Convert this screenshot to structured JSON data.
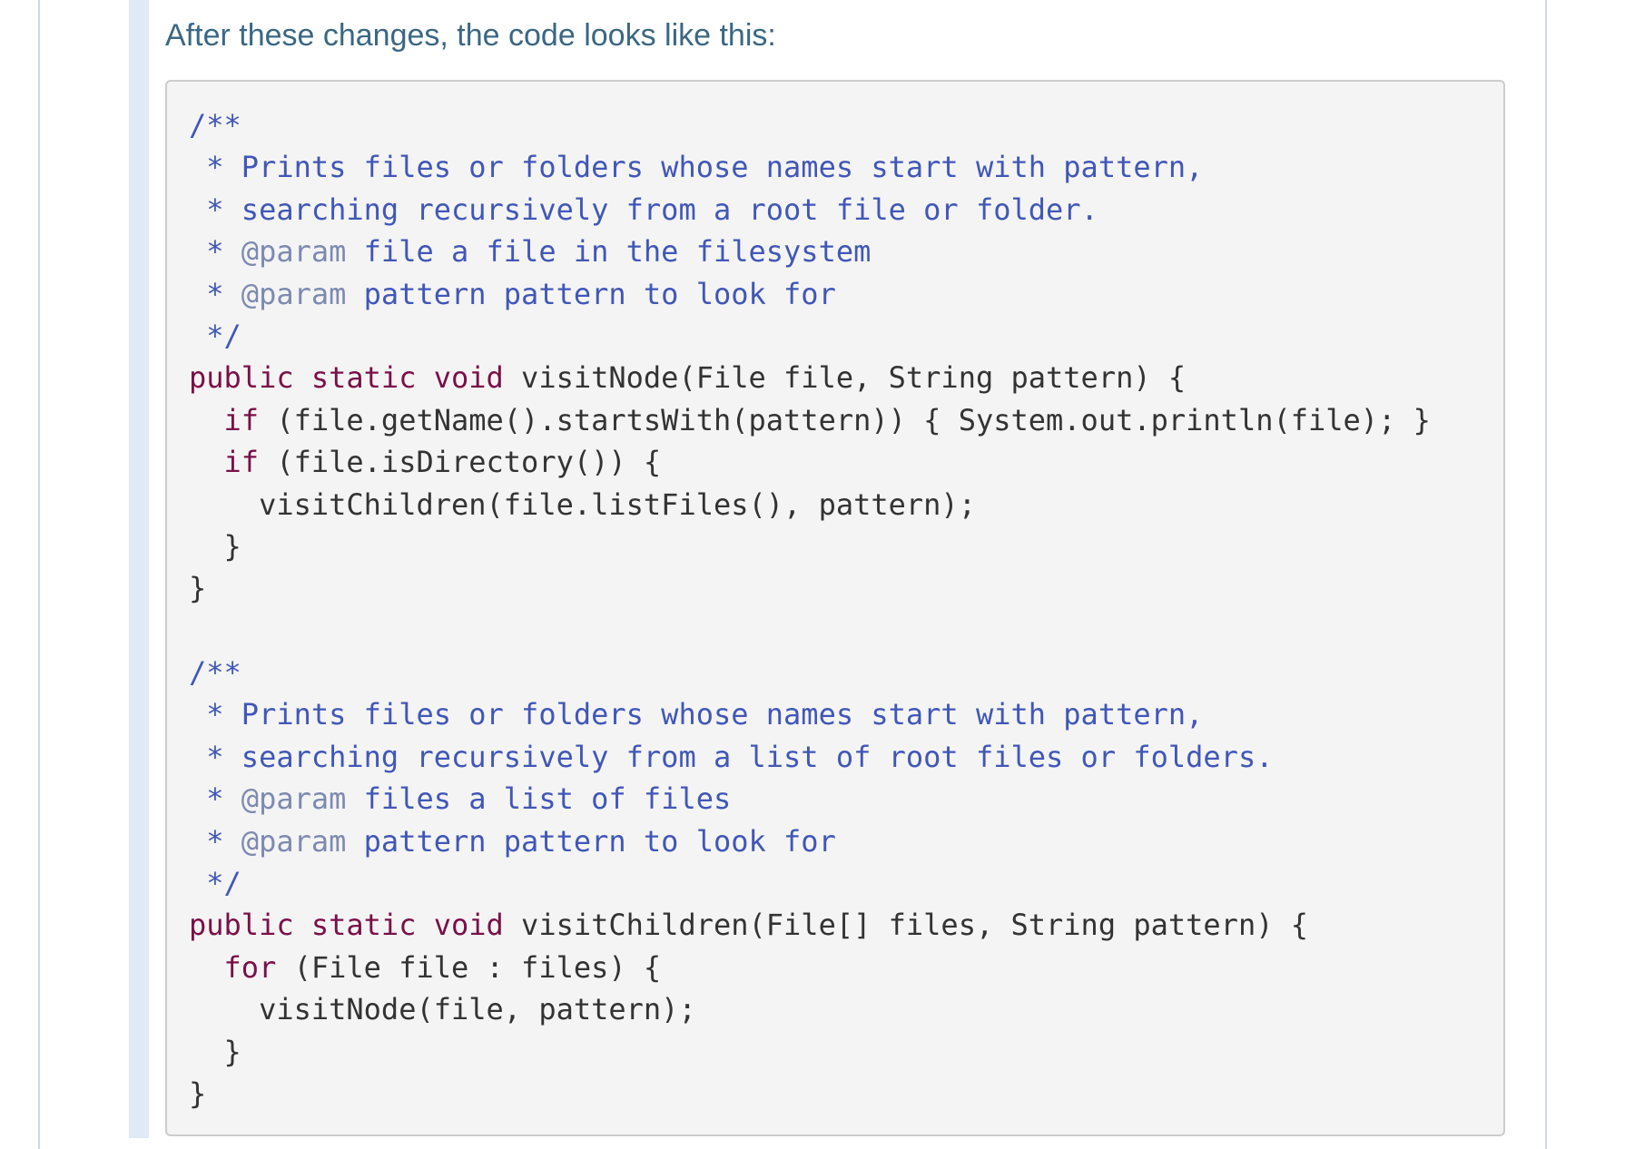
{
  "intro_text": "After these changes, the code looks like this:",
  "colors": {
    "comment": "#4157b7",
    "javadoc_tag": "#7d8ab0",
    "keyword": "#7a1048",
    "plain": "#333333",
    "intro_text": "#3b6783",
    "code_background": "#f4f4f4"
  },
  "code_lines": [
    [
      {
        "t": "/**",
        "c": "cm"
      }
    ],
    [
      {
        "t": " * Prints files or folders whose names start with pattern,",
        "c": "cm"
      }
    ],
    [
      {
        "t": " * searching recursively from a root file or folder.",
        "c": "cm"
      }
    ],
    [
      {
        "t": " * ",
        "c": "cm"
      },
      {
        "t": "@param",
        "c": "tag"
      },
      {
        "t": " file a file in the filesystem",
        "c": "cm"
      }
    ],
    [
      {
        "t": " * ",
        "c": "cm"
      },
      {
        "t": "@param",
        "c": "tag"
      },
      {
        "t": " pattern pattern to look for",
        "c": "cm"
      }
    ],
    [
      {
        "t": " */",
        "c": "cm"
      }
    ],
    [
      {
        "t": "public",
        "c": "kw"
      },
      {
        "t": " ",
        "c": "tx"
      },
      {
        "t": "static",
        "c": "kw"
      },
      {
        "t": " ",
        "c": "tx"
      },
      {
        "t": "void",
        "c": "kw"
      },
      {
        "t": " visitNode(File file, String pattern) {",
        "c": "tx"
      }
    ],
    [
      {
        "t": "  ",
        "c": "tx"
      },
      {
        "t": "if",
        "c": "kw"
      },
      {
        "t": " (file.getName().startsWith(pattern)) { System.out.println(file); }",
        "c": "tx"
      }
    ],
    [
      {
        "t": "  ",
        "c": "tx"
      },
      {
        "t": "if",
        "c": "kw"
      },
      {
        "t": " (file.isDirectory()) {",
        "c": "tx"
      }
    ],
    [
      {
        "t": "    visitChildren(file.listFiles(), pattern);",
        "c": "tx"
      }
    ],
    [
      {
        "t": "  }",
        "c": "tx"
      }
    ],
    [
      {
        "t": "}",
        "c": "tx"
      }
    ],
    [],
    [
      {
        "t": "/**",
        "c": "cm"
      }
    ],
    [
      {
        "t": " * Prints files or folders whose names start with pattern,",
        "c": "cm"
      }
    ],
    [
      {
        "t": " * searching recursively from a list of root files or folders.",
        "c": "cm"
      }
    ],
    [
      {
        "t": " * ",
        "c": "cm"
      },
      {
        "t": "@param",
        "c": "tag"
      },
      {
        "t": " files a list of files",
        "c": "cm"
      }
    ],
    [
      {
        "t": " * ",
        "c": "cm"
      },
      {
        "t": "@param",
        "c": "tag"
      },
      {
        "t": " pattern pattern to look for",
        "c": "cm"
      }
    ],
    [
      {
        "t": " */",
        "c": "cm"
      }
    ],
    [
      {
        "t": "public",
        "c": "kw"
      },
      {
        "t": " ",
        "c": "tx"
      },
      {
        "t": "static",
        "c": "kw"
      },
      {
        "t": " ",
        "c": "tx"
      },
      {
        "t": "void",
        "c": "kw"
      },
      {
        "t": " visitChildren(File[] files, String pattern) {",
        "c": "tx"
      }
    ],
    [
      {
        "t": "  ",
        "c": "tx"
      },
      {
        "t": "for",
        "c": "kw"
      },
      {
        "t": " (File file : files) {",
        "c": "tx"
      }
    ],
    [
      {
        "t": "    visitNode(file, pattern);",
        "c": "tx"
      }
    ],
    [
      {
        "t": "  }",
        "c": "tx"
      }
    ],
    [
      {
        "t": "}",
        "c": "tx"
      }
    ]
  ]
}
